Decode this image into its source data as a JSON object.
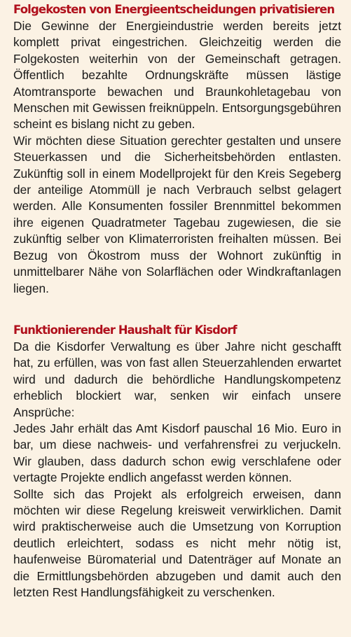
{
  "sections": [
    {
      "heading": "Folgekosten von Energieentscheidungen privatisieren",
      "paragraphs": [
        "Die Gewinne der Energieindustrie werden bereits jetzt komplett privat eingestrichen. Gleichzeitig werden die Folgekosten weiterhin von der Gemeinschaft getragen. Öffentlich bezahlte Ordnungskräfte müssen lästige Atomtransporte bewachen und Braunkohletagebau von Menschen mit Gewissen freiknüppeln. Entsorgungsgebühren scheint es bislang nicht zu geben.",
        "Wir möchten diese Situation gerechter gestalten und unsere Steuerkassen und die Sicherheitsbehörden entlasten. Zukünftig soll in einem Modellprojekt für den Kreis Segeberg der anteilige Atommüll je nach Verbrauch selbst gelagert werden. Alle Konsumenten fossiler Brennmittel bekommen ihre eigenen Quadratmeter Tagebau zugewiesen, die sie zukünftig selber von Klimaterroristen freihalten müssen. Bei Bezug von Ökostrom muss der Wohnort zukünftig in unmittelbarer Nähe von Solarflächen oder Windkraftanlagen liegen."
      ]
    },
    {
      "heading": "Funktionierender Haushalt für Kisdorf",
      "paragraphs": [
        "Da die Kisdorfer Verwaltung es über Jahre nicht geschafft hat, zu erfüllen, was von fast allen Steuerzahlenden erwartet wird und dadurch die behördliche Handlungskompetenz erheblich blockiert war, senken wir einfach unsere Ansprüche:",
        "Jedes Jahr erhält das Amt Kisdorf pauschal 16 Mio. Euro in bar, um diese nachweis- und verfahrensfrei zu verjuckeln. Wir glauben, dass dadurch schon ewig verschlafene oder vertagte Projekte endlich angefasst werden können.",
        "Sollte sich das Projekt als erfolgreich erweisen, dann möchten wir diese Regelung kreisweit verwirklichen. Damit wird praktischerweise auch die Umsetzung von Korruption deutlich erleichtert, sodass es nicht mehr nötig ist, haufenweise Büromaterial und Datenträger auf Monate an die Ermittlungsbehörden abzugeben und damit auch den letzten Rest Handlungsfähigkeit zu verschenken."
      ]
    }
  ]
}
